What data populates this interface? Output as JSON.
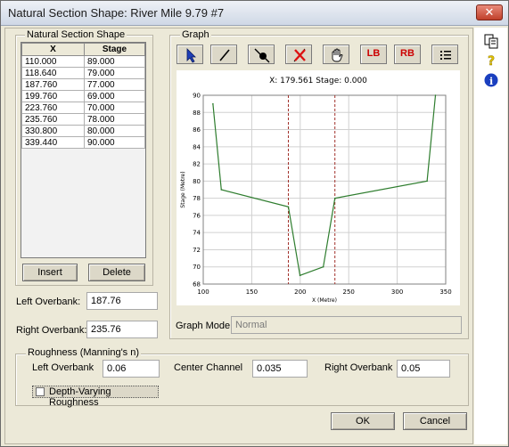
{
  "window": {
    "title": "Natural Section Shape: River Mile 9.79 #7",
    "close_label": "✕"
  },
  "section_shape": {
    "legend": "Natural Section Shape",
    "columns": [
      "X",
      "Stage"
    ],
    "rows": [
      [
        "110.000",
        "89.000"
      ],
      [
        "118.640",
        "79.000"
      ],
      [
        "187.760",
        "77.000"
      ],
      [
        "199.760",
        "69.000"
      ],
      [
        "223.760",
        "70.000"
      ],
      [
        "235.760",
        "78.000"
      ],
      [
        "330.800",
        "80.000"
      ],
      [
        "339.440",
        "90.000"
      ]
    ],
    "insert_label": "Insert",
    "delete_label": "Delete"
  },
  "overbank": {
    "left_label": "Left Overbank:",
    "left_value": "187.76",
    "right_label": "Right Overbank:",
    "right_value": "235.76"
  },
  "graph": {
    "legend": "Graph",
    "tools": [
      {
        "icon": "arrow-select-icon"
      },
      {
        "icon": "line-draw-icon"
      },
      {
        "icon": "add-point-icon"
      },
      {
        "icon": "delete-point-icon"
      },
      {
        "icon": "hand-pan-icon"
      },
      {
        "icon": "left-bank-icon",
        "text": "LB"
      },
      {
        "icon": "right-bank-icon",
        "text": "RB"
      },
      {
        "icon": "list-icon"
      }
    ],
    "readout": "X: 179.561 Stage: 0.000",
    "mode_label": "Graph Mode",
    "mode_value": "Normal"
  },
  "chart_data": {
    "type": "line",
    "x": [
      110,
      118.64,
      187.76,
      199.76,
      223.76,
      235.76,
      330.8,
      339.44
    ],
    "y": [
      89,
      79,
      77,
      69,
      70,
      78,
      80,
      90
    ],
    "xlabel": "X (Metre)",
    "ylabel": "Stage (Metre)",
    "xlim": [
      100,
      350
    ],
    "ylim": [
      68,
      90
    ],
    "xticks": [
      100,
      150,
      200,
      250,
      300,
      350
    ],
    "yticks": [
      68,
      70,
      72,
      74,
      76,
      78,
      80,
      82,
      84,
      86,
      88,
      90
    ],
    "bank_lines": [
      187.76,
      235.76
    ],
    "line_color": "#2e7d2e",
    "bank_color": "#a0302a",
    "grid": true
  },
  "roughness": {
    "legend": "Roughness (Manning's n)",
    "left_label": "Left Overbank",
    "left_value": "0.06",
    "center_label": "Center Channel",
    "center_value": "0.035",
    "right_label": "Right Overbank",
    "right_value": "0.05",
    "depth_varying_label": "Depth-Varying Roughness"
  },
  "buttons": {
    "ok": "OK",
    "cancel": "Cancel"
  },
  "side_icons": [
    "copy-icon",
    "help-icon",
    "info-icon"
  ]
}
